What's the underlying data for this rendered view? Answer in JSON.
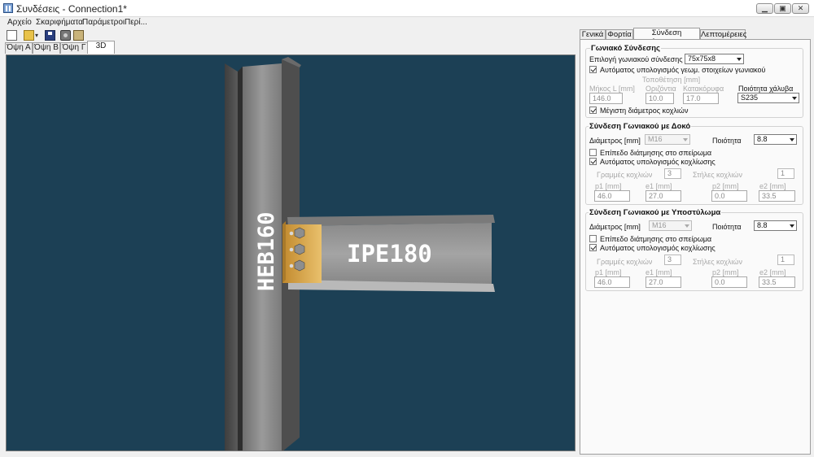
{
  "window": {
    "title": "Συνδέσεις - Connection1*",
    "minimize_glyph": "▁",
    "maximize_glyph": "▣",
    "close_glyph": "✕"
  },
  "menu": {
    "items": [
      "Αρχείο",
      "Σκαριφήματα",
      "Παράμετροι",
      "Περί..."
    ]
  },
  "toolbar": {
    "icons": [
      "new-file-icon",
      "open-folder-icon",
      "save-icon",
      "camera-icon",
      "print-icon"
    ],
    "dropdown_glyph": "▾"
  },
  "view_tabs": [
    {
      "label": "Όψη Α",
      "active": false
    },
    {
      "label": "Όψη Β",
      "active": false
    },
    {
      "label": "Όψη Γ",
      "active": false
    },
    {
      "label": "3D",
      "active": true
    }
  ],
  "viewport": {
    "background": "#1c4055",
    "column_label": "HEB160",
    "beam_label": "IPE180",
    "steel_color": "#8e8e8e",
    "cleat_color": "#e0b25a"
  },
  "panel_tabs": [
    {
      "label": "Γενικά",
      "active": false
    },
    {
      "label": "Φορτία",
      "active": false
    },
    {
      "label": "Σύνδεση τέμνουσας",
      "active": true
    },
    {
      "label": "Λεπτομέρειες",
      "active": false
    }
  ],
  "angle_section": {
    "title": "Γωνιακό Σύνδεσης",
    "select_label": "Επιλογή γωνιακού σύνδεσης",
    "select_value": "75x75x8",
    "auto_geom_label": "Αυτόματος υπολογισμός γεωμ. στοιχείων γωνιακού",
    "auto_geom_checked": true,
    "placement_label": "Τοποθέτηση [mm]",
    "length_label": "Μήκος L [mm]",
    "horizontal_label": "Οριζόντια",
    "vertical_label": "Κατακόρυφα",
    "steel_grade_label": "Ποιότητα χάλυβα",
    "length_value": "146.0",
    "horizontal_value": "10.0",
    "vertical_value": "17.0",
    "steel_grade_value": "S235",
    "max_diameter_label": "Μέγιστη διάμετρος κοχλιών",
    "max_diameter_checked": true
  },
  "beam_connection": {
    "title": "Σύνδεση Γωνιακού με Δοκό",
    "diameter_label": "Διάμετρος [mm]",
    "diameter_value": "M16",
    "quality_label": "Ποιότητα",
    "quality_value": "8.8",
    "shear_plane_label": "Επίπεδο διάτμησης στο σπείρωμα",
    "shear_plane_checked": false,
    "auto_bolting_label": "Αυτόματος υπολογισμός κοχλίωσης",
    "auto_bolting_checked": true,
    "rows_label": "Γραμμές κοχλιών",
    "rows_value": "3",
    "cols_label": "Στήλες κοχλιών",
    "cols_value": "1",
    "p1_label": "p1 [mm]",
    "e1_label": "e1 [mm]",
    "p2_label": "p2 [mm]",
    "e2_label": "e2 [mm]",
    "p1_value": "46.0",
    "e1_value": "27.0",
    "p2_value": "0.0",
    "e2_value": "33.5"
  },
  "column_connection": {
    "title": "Σύνδεση Γωνιακού με Υποστύλωμα",
    "diameter_label": "Διάμετρος [mm]",
    "diameter_value": "M16",
    "quality_label": "Ποιότητα",
    "quality_value": "8.8",
    "shear_plane_label": "Επίπεδο διάτμησης στο σπείρωμα",
    "shear_plane_checked": false,
    "auto_bolting_label": "Αυτόματος υπολογισμός κοχλίωσης",
    "auto_bolting_checked": true,
    "rows_label": "Γραμμές κοχλιών",
    "rows_value": "3",
    "cols_label": "Στήλες κοχλιών",
    "cols_value": "1",
    "p1_label": "p1 [mm]",
    "e1_label": "e1 [mm]",
    "p2_label": "p2 [mm]",
    "e2_label": "e2 [mm]",
    "p1_value": "46.0",
    "e1_value": "27.0",
    "p2_value": "0.0",
    "e2_value": "33.5"
  }
}
